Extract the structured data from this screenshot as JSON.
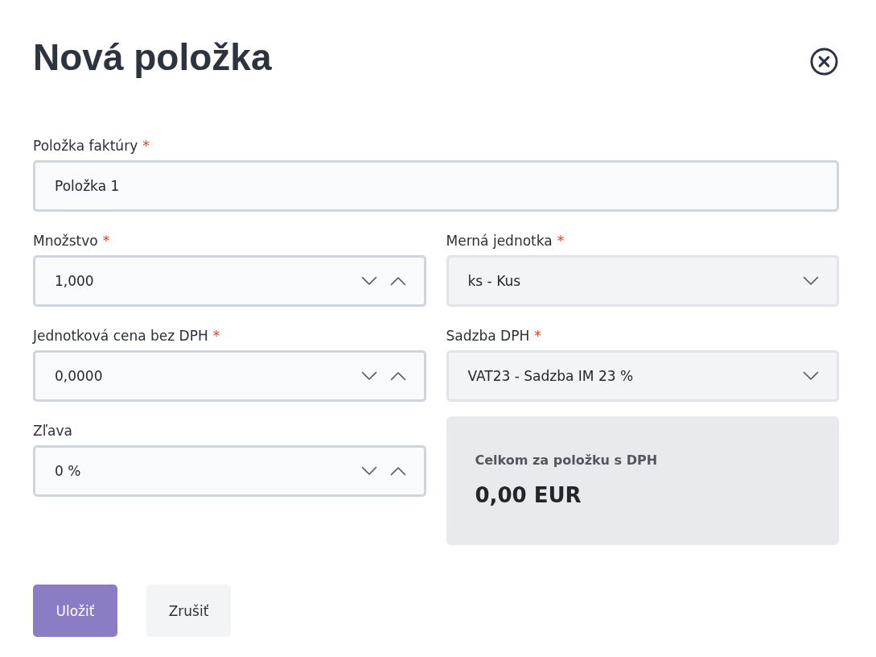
{
  "dialog": {
    "title": "Nová položka"
  },
  "fields": [
    {
      "kind": "text",
      "label": "Položka faktúry",
      "required_mark": "*",
      "value": "Položka 1"
    },
    {
      "kind": "number",
      "label": "Množstvo",
      "required_mark": "*",
      "value": "1,000"
    },
    {
      "kind": "select",
      "label": "Merná jednotka",
      "required_mark": "*",
      "value": "ks - Kus"
    },
    {
      "kind": "number",
      "label": "Jednotková cena bez DPH",
      "required_mark": "*",
      "value": "0,0000"
    },
    {
      "kind": "select",
      "label": "Sadzba DPH",
      "required_mark": "*",
      "value": "VAT23 - Sadzba IM 23 %"
    },
    {
      "kind": "number",
      "label": "Zľava",
      "value": "0 %"
    }
  ],
  "summary": {
    "label": "Celkom za položku s DPH",
    "value": "0,00 EUR"
  },
  "buttons": [
    {
      "kind": "primary",
      "label": "Uložiť"
    },
    {
      "kind": "secondary",
      "label": "Zrušiť"
    }
  ]
}
